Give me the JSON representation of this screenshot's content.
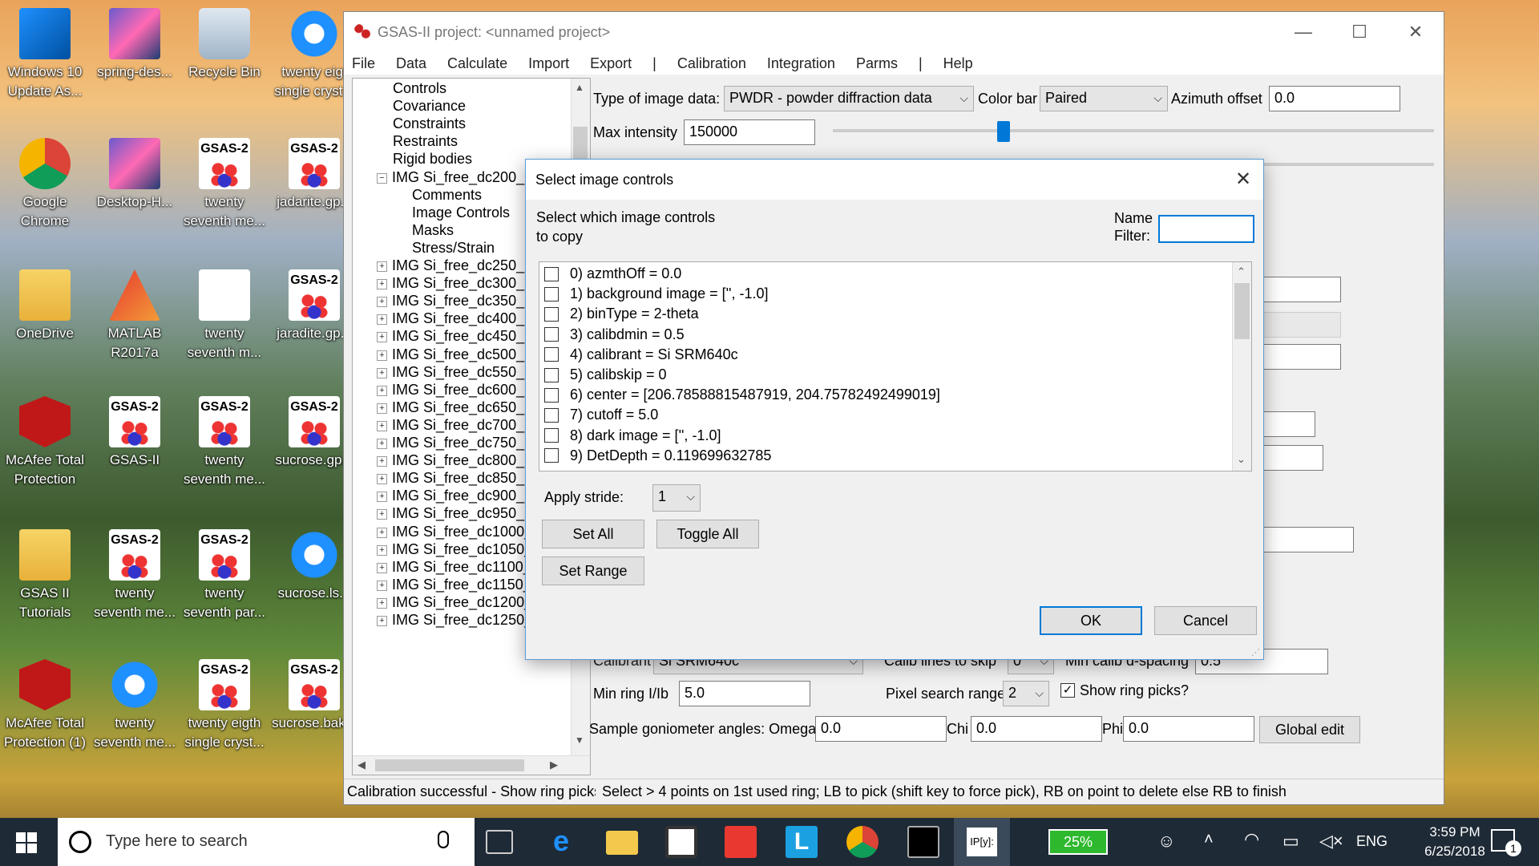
{
  "desktop": {
    "icons": [
      {
        "label": "Windows 10 Update As...",
        "kind": "win"
      },
      {
        "label": "spring-des...",
        "kind": "photo"
      },
      {
        "label": "Recycle Bin",
        "kind": "bin"
      },
      {
        "label": "twenty eigt single cryst...",
        "kind": "ie"
      },
      {
        "label": "Google Chrome",
        "kind": "chrome"
      },
      {
        "label": "Desktop-H...",
        "kind": "photo"
      },
      {
        "label": "twenty seventh me...",
        "kind": "gsas"
      },
      {
        "label": "jadarite.gp...",
        "kind": "gsas"
      },
      {
        "label": "OneDrive",
        "kind": "folder"
      },
      {
        "label": "MATLAB R2017a",
        "kind": "matlab"
      },
      {
        "label": "twenty seventh m...",
        "kind": "doc"
      },
      {
        "label": "jaradite.gp...",
        "kind": "gsas"
      },
      {
        "label": "McAfee Total Protection",
        "kind": "mcafee"
      },
      {
        "label": "GSAS-II",
        "kind": "gsas"
      },
      {
        "label": "twenty seventh me...",
        "kind": "gsas"
      },
      {
        "label": "sucrose.gp...",
        "kind": "gsas"
      },
      {
        "label": "GSAS II Tutorials",
        "kind": "chrome-doc"
      },
      {
        "label": "twenty seventh me...",
        "kind": "gsas"
      },
      {
        "label": "twenty seventh par...",
        "kind": "gsas"
      },
      {
        "label": "sucrose.ls...",
        "kind": "ie"
      },
      {
        "label": "McAfee Total Protection (1)",
        "kind": "mcafee"
      },
      {
        "label": "twenty seventh me...",
        "kind": "ie"
      },
      {
        "label": "twenty eigth single cryst...",
        "kind": "gsas"
      },
      {
        "label": "sucrose.bak...",
        "kind": "gsas"
      }
    ],
    "gsas_badge": "GSAS-2"
  },
  "window": {
    "title": "GSAS-II project: <unnamed project>",
    "minimize": "—",
    "maximize": "☐",
    "close": "✕",
    "menu": [
      "File",
      "Data",
      "Calculate",
      "Import",
      "Export",
      "|",
      "Calibration",
      "Integration",
      "Parms",
      "|",
      "Help"
    ]
  },
  "tree": {
    "items": [
      {
        "label": "Controls",
        "level": 1,
        "pm": ""
      },
      {
        "label": "Covariance",
        "level": 1,
        "pm": ""
      },
      {
        "label": "Constraints",
        "level": 1,
        "pm": ""
      },
      {
        "label": "Restraints",
        "level": 1,
        "pm": ""
      },
      {
        "label": "Rigid bodies",
        "level": 1,
        "pm": ""
      },
      {
        "label": "IMG Si_free_dc200_1",
        "level": 1,
        "pm": "−"
      },
      {
        "label": "Comments",
        "level": 2,
        "pm": ""
      },
      {
        "label": "Image Controls",
        "level": 2,
        "pm": ""
      },
      {
        "label": "Masks",
        "level": 2,
        "pm": ""
      },
      {
        "label": "Stress/Strain",
        "level": 2,
        "pm": ""
      },
      {
        "label": "IMG Si_free_dc250_1",
        "level": 1,
        "pm": "+"
      },
      {
        "label": "IMG Si_free_dc300_1",
        "level": 1,
        "pm": "+"
      },
      {
        "label": "IMG Si_free_dc350_1",
        "level": 1,
        "pm": "+"
      },
      {
        "label": "IMG Si_free_dc400_1",
        "level": 1,
        "pm": "+"
      },
      {
        "label": "IMG Si_free_dc450_1",
        "level": 1,
        "pm": "+"
      },
      {
        "label": "IMG Si_free_dc500_1",
        "level": 1,
        "pm": "+"
      },
      {
        "label": "IMG Si_free_dc550_1",
        "level": 1,
        "pm": "+"
      },
      {
        "label": "IMG Si_free_dc600_1",
        "level": 1,
        "pm": "+"
      },
      {
        "label": "IMG Si_free_dc650_1",
        "level": 1,
        "pm": "+"
      },
      {
        "label": "IMG Si_free_dc700_1",
        "level": 1,
        "pm": "+"
      },
      {
        "label": "IMG Si_free_dc750_1",
        "level": 1,
        "pm": "+"
      },
      {
        "label": "IMG Si_free_dc800_1",
        "level": 1,
        "pm": "+"
      },
      {
        "label": "IMG Si_free_dc850_1",
        "level": 1,
        "pm": "+"
      },
      {
        "label": "IMG Si_free_dc900_1",
        "level": 1,
        "pm": "+"
      },
      {
        "label": "IMG Si_free_dc950_1",
        "level": 1,
        "pm": "+"
      },
      {
        "label": "IMG Si_free_dc1000_",
        "level": 1,
        "pm": "+"
      },
      {
        "label": "IMG Si_free_dc1050_",
        "level": 1,
        "pm": "+"
      },
      {
        "label": "IMG Si_free_dc1100_1-00(",
        "level": 1,
        "pm": "+"
      },
      {
        "label": "IMG Si_free_dc1150_1-00(",
        "level": 1,
        "pm": "+"
      },
      {
        "label": "IMG Si_free_dc1200_1-00(",
        "level": 1,
        "pm": "+"
      },
      {
        "label": "IMG Si_free_dc1250_1-00(",
        "level": 1,
        "pm": "+"
      }
    ]
  },
  "controls": {
    "type_label": "Type of image data:",
    "type_value": "PWDR - powder diffraction data",
    "colorbar_label": "Color bar",
    "colorbar_value": "Paired",
    "azimuth_label": "Azimuth offset",
    "azimuth_value": "0.0",
    "maxint_label": "Max intensity",
    "maxint_value": "150000",
    "calibrant_label": "Calibrant",
    "calibrant_value": "Si    SRM640c",
    "calib_skip_label": "Calib lines to skip",
    "calib_skip_value": "0",
    "min_dspacing_label": "Min calib d-spacing",
    "min_dspacing_value": "0.5",
    "min_ring_label": "Min ring I/Ib",
    "min_ring_value": "5.0",
    "pixel_search_label": "Pixel search range",
    "pixel_search_value": "2",
    "show_ring_label": "Show ring picks?",
    "goniometer_label": "Sample goniometer angles: Omega",
    "omega_value": "0.0",
    "chi_label": "Chi",
    "chi_value": "0.0",
    "phi_label": "Phi",
    "phi_value": "0.0",
    "global_edit": "Global edit"
  },
  "status": {
    "left": "Calibration successful - Show ring picks",
    "right": "Select > 4 points on 1st used ring; LB to pick (shift key to force pick), RB on point to delete else RB to finish"
  },
  "dialog": {
    "title": "Select image controls",
    "prompt_line1": "Select which image controls",
    "prompt_line2": "to copy",
    "name_filter_line1": "Name",
    "name_filter_line2": "Filter:",
    "name_filter_value": "",
    "items": [
      "0) azmthOff = 0.0",
      "1) background image = ['', -1.0]",
      "2) binType = 2-theta",
      "3) calibdmin = 0.5",
      "4) calibrant = Si    SRM640c",
      "5) calibskip = 0",
      "6) center = [206.78588815487919, 204.75782492499019]",
      "7) cutoff = 5.0",
      "8) dark image = ['', -1.0]",
      "9) DetDepth = 0.119699632785"
    ],
    "apply_stride_label": "Apply stride:",
    "apply_stride_value": "1",
    "set_all": "Set All",
    "toggle_all": "Toggle All",
    "set_range": "Set Range",
    "ok": "OK",
    "cancel": "Cancel"
  },
  "taskbar": {
    "search_placeholder": "Type here to search",
    "battery": "25%",
    "lang": "ENG",
    "time": "3:59 PM",
    "date": "6/25/2018",
    "notifications": "1"
  }
}
